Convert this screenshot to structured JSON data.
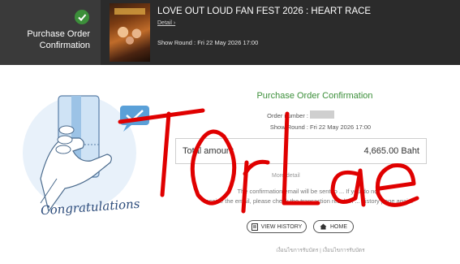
{
  "header": {
    "step_line1": "Purchase Order",
    "step_line2": "Confirmation",
    "event_title": "LOVE OUT LOUD FAN FEST 2026 : HEART RACE",
    "detail_link": "Detail ›",
    "show_round": "Show Round   : Fri 22 May 2026 17:00"
  },
  "illustration": {
    "caption": "Congratulations"
  },
  "main": {
    "title": "Purchase Order Confirmation",
    "order_number_label": "Order number :",
    "show_round_label": "Show Round :",
    "show_round_value": "Fri 22 May 2026 17:00",
    "total_label": "Total amount",
    "total_value": "4,665.00 Baht",
    "more_detail": "More detail",
    "message_line1": "The confirmation email will be sent to ... If you do not",
    "message_line2": "receive the email, please check the transaction result in ... history page again.",
    "buttons": {
      "view_history": "VIEW HISTORY",
      "home": "HOME"
    },
    "footer_links": "เงื่อนไขการรับบัตร | เงื่อนไขการรับบัตร"
  },
  "overlay": {
    "scribble_text": "TOrLae"
  },
  "colors": {
    "accent_green": "#3c8f3a",
    "header_bg": "#2b2b2b",
    "scribble_red": "#e00000"
  }
}
